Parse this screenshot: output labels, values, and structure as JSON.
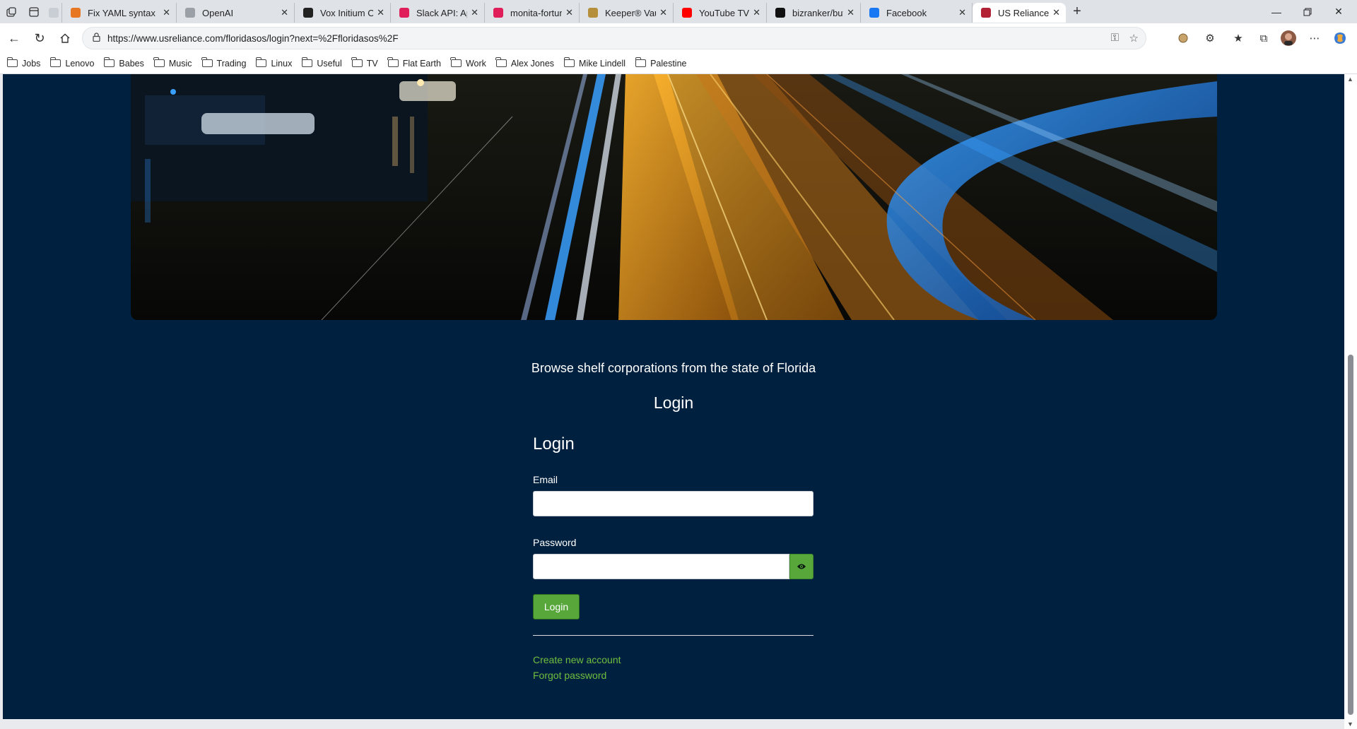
{
  "browser": {
    "tabs": [
      {
        "title": "Fix YAML syntax",
        "favicon_color": "#e87722"
      },
      {
        "title": "OpenAI",
        "favicon_color": "#9aa0a6"
      },
      {
        "title": "Vox Initium Overview",
        "favicon_color": "#222222"
      },
      {
        "title": "Slack API: Applications",
        "favicon_color": "#e01e5a"
      },
      {
        "title": "monita-fortuna (Cl",
        "favicon_color": "#e01e5a"
      },
      {
        "title": "Keeper® Vault Log",
        "favicon_color": "#b58f3c"
      },
      {
        "title": "YouTube TV - Watc",
        "favicon_color": "#ff0000"
      },
      {
        "title": "bizranker/butabi-b",
        "favicon_color": "#111111"
      },
      {
        "title": "Facebook",
        "favicon_color": "#1877f2"
      },
      {
        "title": "US Reliance | BizRa",
        "favicon_color": "#b22234",
        "active": true
      }
    ],
    "address": {
      "url": "https://www.usreliance.com/floridasos/login?next=%2Ffloridasos%2F"
    },
    "bookmarks": [
      "Jobs",
      "Lenovo",
      "Babes",
      "Music",
      "Trading",
      "Linux",
      "Useful",
      "TV",
      "Flat Earth",
      "Work",
      "Alex Jones",
      "Mike Lindell",
      "Palestine"
    ],
    "icons": {
      "tab_actions": "tab-actions-icon",
      "vertical_tabs": "vertical-tabs-icon",
      "new_tab": "plus-icon",
      "minimize": "minimize-icon",
      "restore": "restore-icon",
      "close": "close-icon",
      "back": "back-arrow-icon",
      "refresh": "refresh-icon",
      "home": "home-icon",
      "lock": "lock-icon",
      "key": "key-icon",
      "favorite": "star-icon",
      "extensions": "puzzle-icon",
      "favorites": "favorites-icon",
      "collections": "collections-icon",
      "profile": "avatar",
      "more": "more-icon",
      "copilot": "copilot-icon"
    }
  },
  "page": {
    "subtitle": "Browse shelf corporations from the state of Florida",
    "heading": "Login",
    "form": {
      "title": "Login",
      "email_label": "Email",
      "email_value": "",
      "password_label": "Password",
      "password_value": "",
      "show_password_icon": "eye-icon",
      "submit_label": "Login",
      "create_account_link": "Create new account",
      "forgot_password_link": "Forgot password"
    },
    "colors": {
      "background": "#00203f",
      "accent_green": "#57a73b",
      "link_green": "#6fbf3e"
    }
  }
}
